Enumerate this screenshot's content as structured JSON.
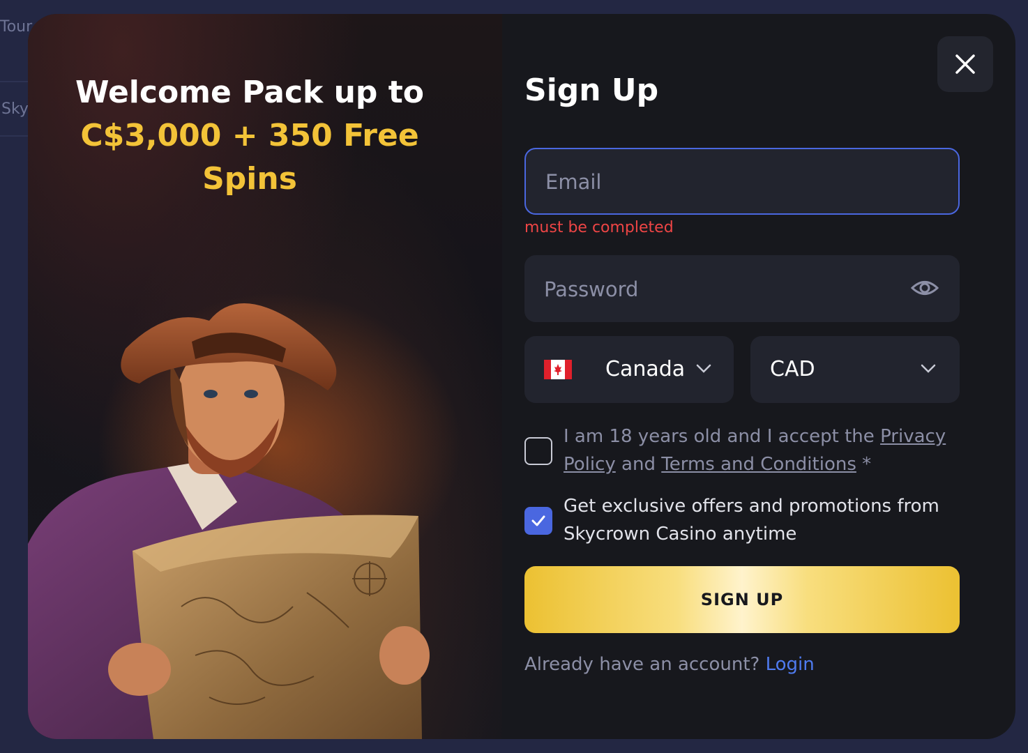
{
  "background": {
    "fragments": [
      "Tour",
      "Sky"
    ]
  },
  "promo": {
    "line1": "Welcome Pack up to",
    "line2": "C$3,000 + 350 Free Spins"
  },
  "form": {
    "title": "Sign Up",
    "email": {
      "placeholder": "Email",
      "value": "",
      "error": "must be completed"
    },
    "password": {
      "placeholder": "Password",
      "value": ""
    },
    "country": {
      "selected": "Canada",
      "flag": "canada-flag-icon"
    },
    "currency": {
      "selected": "CAD"
    },
    "terms": {
      "prefix": "I am 18 years old and I accept the ",
      "privacy_link": "Privacy Policy",
      "middle": " and ",
      "terms_link": "Terms and Conditions",
      "suffix": " *",
      "checked": false
    },
    "offers": {
      "text": "Get exclusive offers and promotions from Skycrown Casino anytime",
      "checked": true
    },
    "submit_label": "SIGN UP",
    "login_prompt": "Already have an account? ",
    "login_link": "Login"
  },
  "colors": {
    "accent_blue": "#4a67e0",
    "gold": "#f3c338",
    "error": "#ee4545",
    "modal_bg": "#17181d",
    "field_bg": "#22242e"
  }
}
